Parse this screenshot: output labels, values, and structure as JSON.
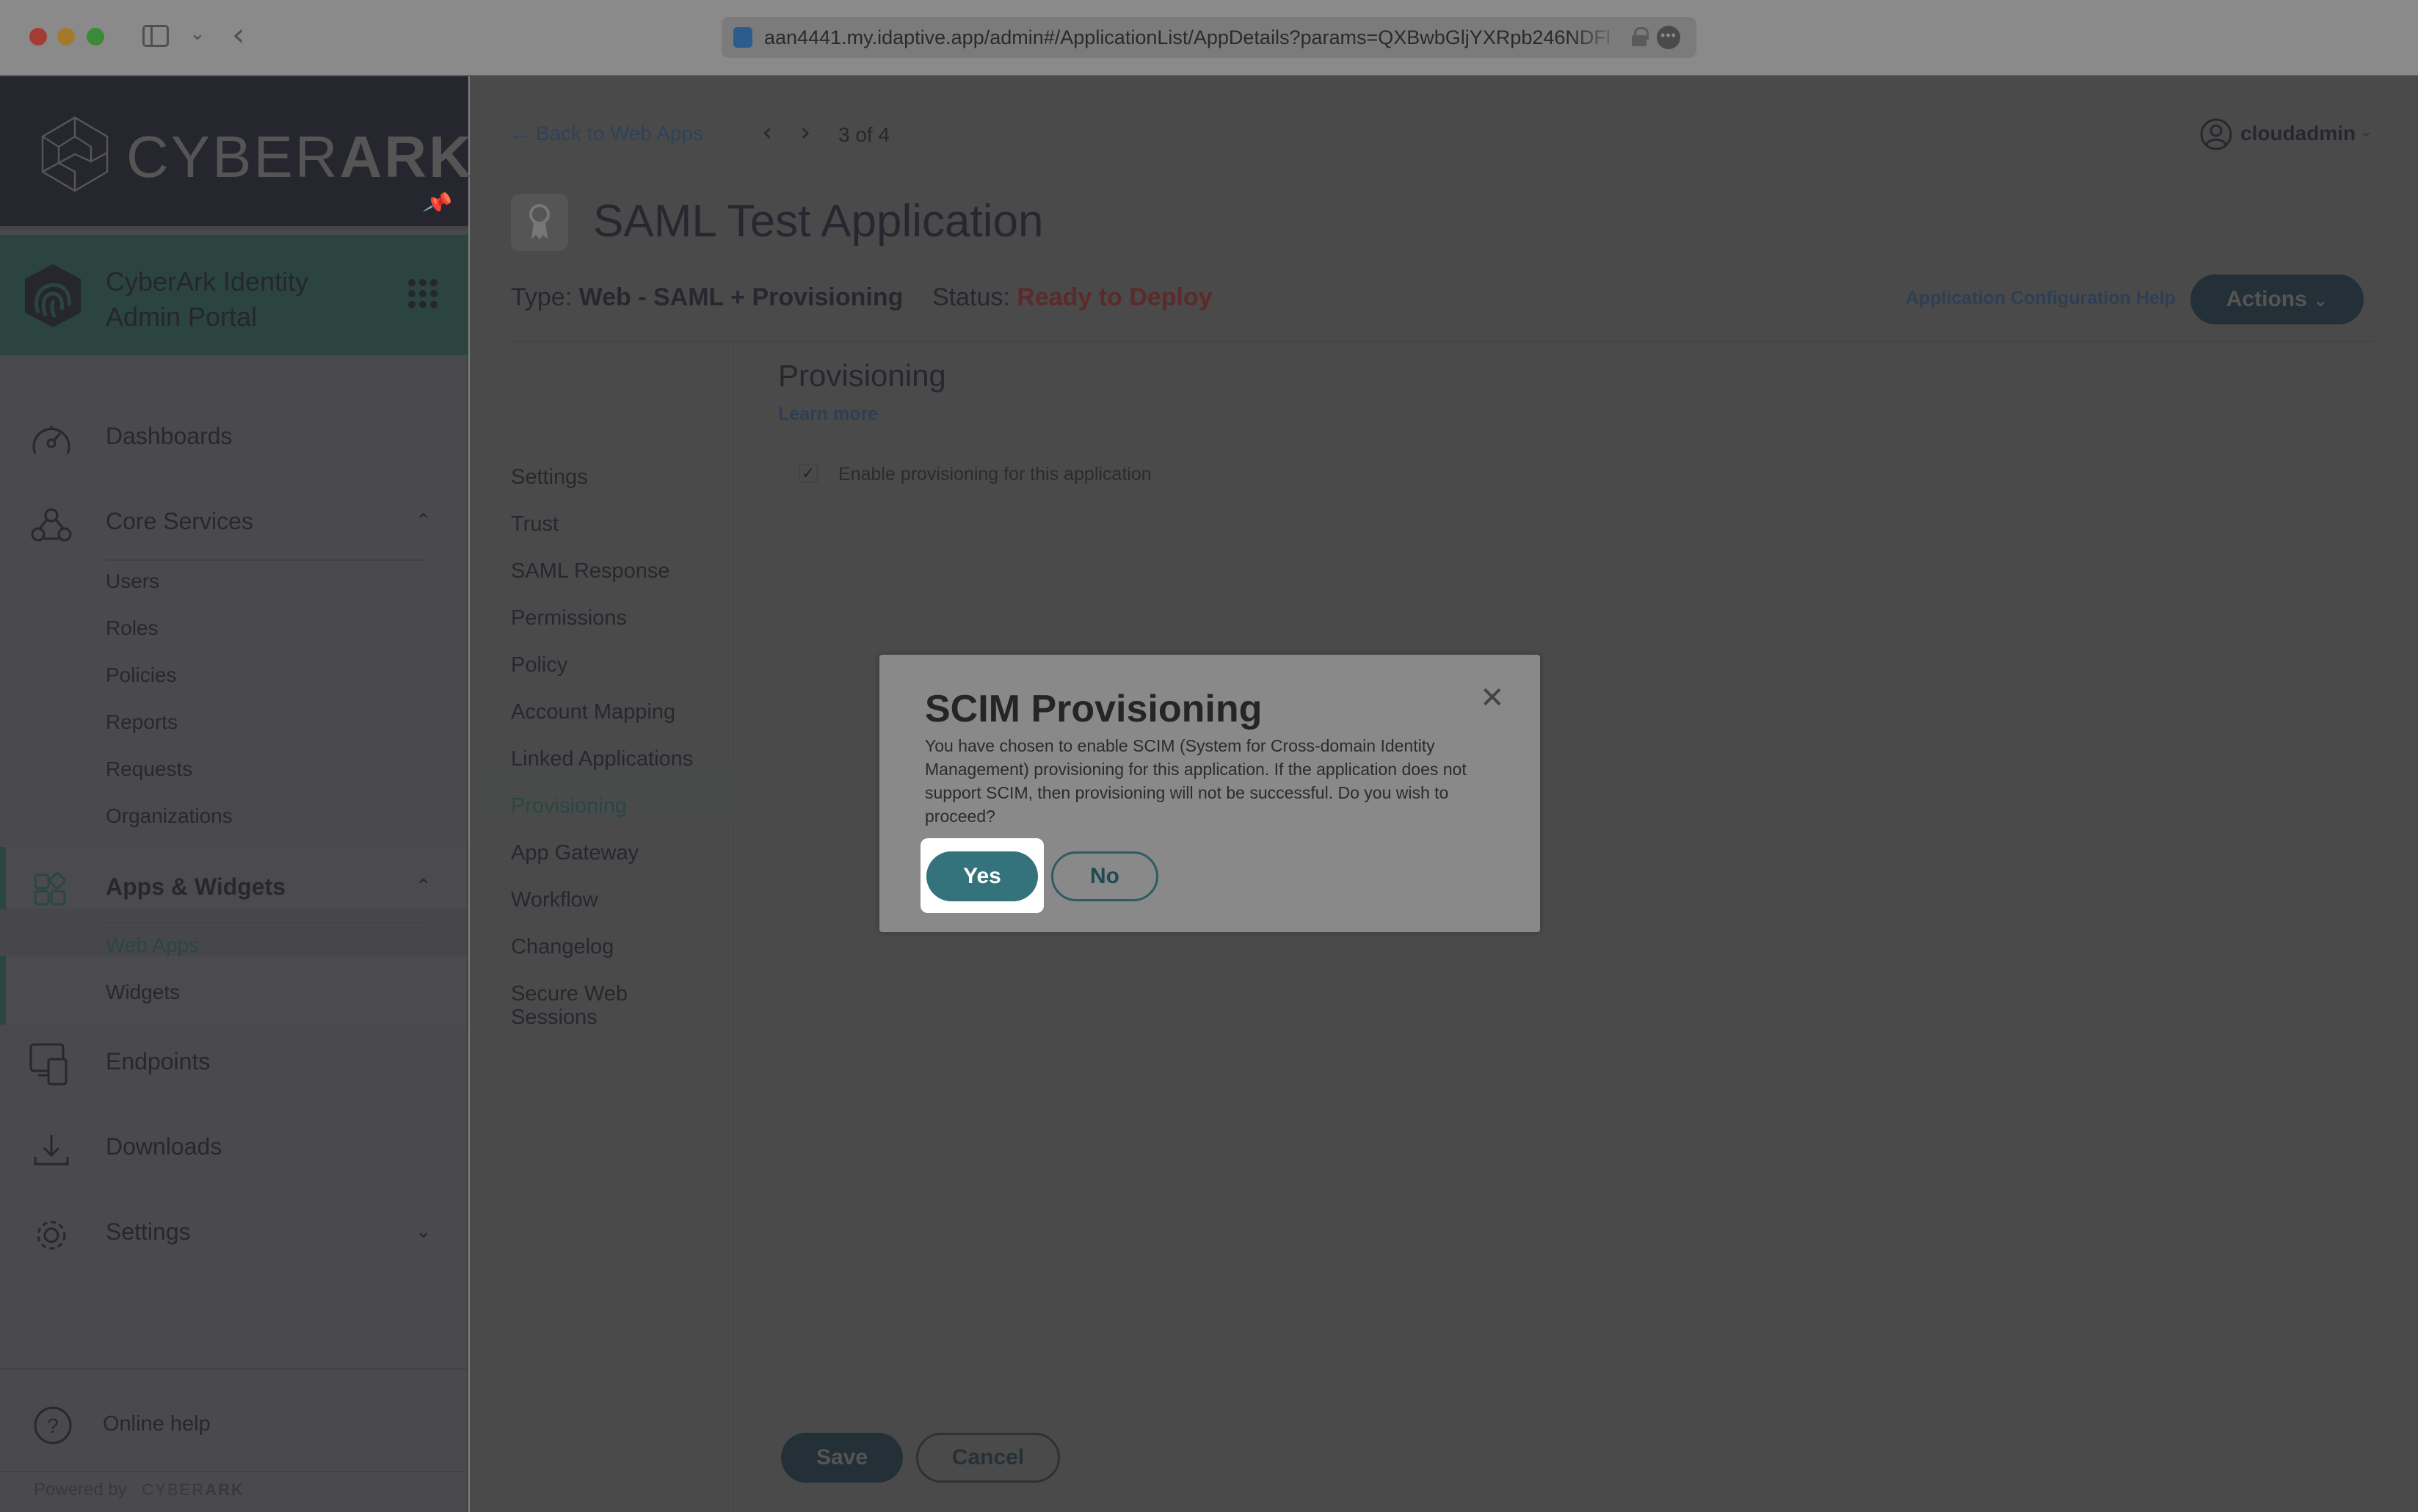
{
  "browser": {
    "url": "aan4441.my.idaptive.app/admin#/ApplicationList/AppDetails?params=QXBwbGljYXRpb246NDFl"
  },
  "sidebar": {
    "brand_light": "CYBER",
    "brand_bold": "ARK",
    "portal_title_line1": "CyberArk Identity",
    "portal_title_line2": "Admin Portal",
    "items": [
      {
        "label": "Dashboards",
        "icon": "dashboard-gauge-icon"
      },
      {
        "label": "Core Services",
        "icon": "core-services-icon",
        "expanded": true,
        "children": [
          "Users",
          "Roles",
          "Policies",
          "Reports",
          "Requests",
          "Organizations"
        ]
      },
      {
        "label": "Apps & Widgets",
        "icon": "apps-widgets-icon",
        "expanded": true,
        "children": [
          "Web Apps",
          "Widgets"
        ],
        "active_child": "Web Apps"
      },
      {
        "label": "Endpoints",
        "icon": "endpoints-icon"
      },
      {
        "label": "Downloads",
        "icon": "download-icon"
      },
      {
        "label": "Settings",
        "icon": "gear-icon",
        "expanded": false
      }
    ],
    "online_help": "Online help",
    "powered_by": "Powered by",
    "powered_brand_light": "CYBER",
    "powered_brand_bold": "ARK"
  },
  "header": {
    "back_link": "Back to Web Apps",
    "pager": "3 of 4",
    "user": "cloudadmin",
    "app_title": "SAML Test Application",
    "type_label": "Type:",
    "type_value": "Web - SAML + Provisioning",
    "status_label": "Status:",
    "status_value": "Ready to Deploy",
    "help_link": "Application Configuration Help",
    "actions_label": "Actions"
  },
  "section_nav": {
    "items": [
      "Settings",
      "Trust",
      "SAML Response",
      "Permissions",
      "Policy",
      "Account Mapping",
      "Linked Applications",
      "Provisioning",
      "App Gateway",
      "Workflow",
      "Changelog",
      "Secure Web Sessions"
    ],
    "active": "Provisioning"
  },
  "content": {
    "title": "Provisioning",
    "learn_more": "Learn more",
    "enable_checkbox_label": "Enable provisioning for this application",
    "enable_checked": true,
    "save": "Save",
    "cancel": "Cancel"
  },
  "modal": {
    "title": "SCIM Provisioning",
    "body": "You have chosen to enable SCIM (System for Cross-domain Identity Management) provisioning for this application. If the application does not support SCIM, then provisioning will not be successful. Do you wish to proceed?",
    "yes": "Yes",
    "no": "No"
  },
  "colors": {
    "primary_teal": "#34737c",
    "status_red": "#5c2a2a",
    "link_blue": "#2e3f54"
  }
}
